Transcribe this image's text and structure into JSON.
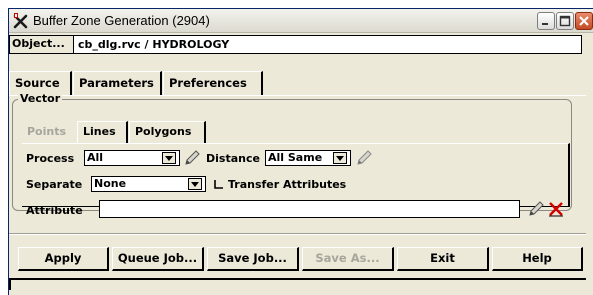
{
  "window": {
    "title": "Buffer Zone Generation (2904)",
    "accent": "#0a246a",
    "close_color": "#c34a25"
  },
  "object": {
    "button_label": "Object...",
    "value": "cb_dlg.rvc / HYDROLOGY"
  },
  "tabs": [
    {
      "label": "Source",
      "selected": true
    },
    {
      "label": "Parameters",
      "selected": false
    },
    {
      "label": "Preferences",
      "selected": false
    }
  ],
  "vector_group": {
    "legend": "Vector",
    "subtabs": [
      {
        "label": "Points",
        "disabled": true
      },
      {
        "label": "Lines",
        "selected": true
      },
      {
        "label": "Polygons",
        "selected": false
      }
    ],
    "process": {
      "label": "Process",
      "value": "All"
    },
    "distance": {
      "label": "Distance",
      "value": "All Same"
    },
    "separate": {
      "label": "Separate",
      "value": "None"
    },
    "transfer": {
      "label": "Transfer Attributes",
      "checked": false
    },
    "attribute": {
      "label": "Attribute",
      "value": ""
    }
  },
  "icons": [
    "pencil-edit-icon",
    "delete-x-icon",
    "minimize-icon",
    "maximize-icon",
    "close-icon",
    "app-icon"
  ],
  "buttons": {
    "apply": "Apply",
    "queue_job": "Queue Job...",
    "save_job": "Save Job...",
    "save_as": "Save As...",
    "exit": "Exit",
    "help": "Help"
  }
}
